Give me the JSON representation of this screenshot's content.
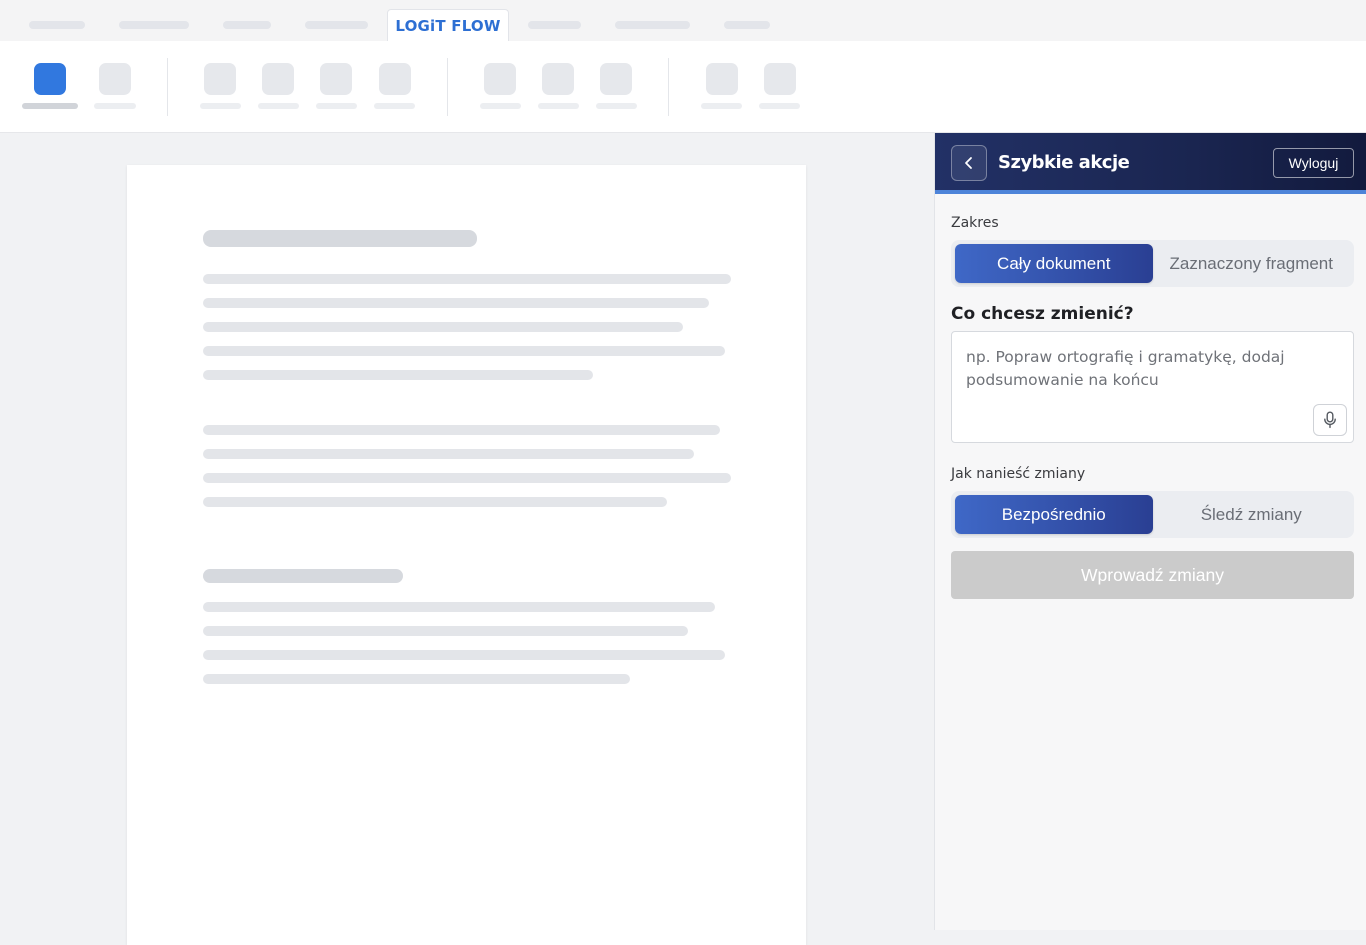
{
  "tabs": {
    "active_label": "LOGiT FLOW"
  },
  "panel": {
    "title": "Szybkie akcje",
    "logout_label": "Wyloguj",
    "scope": {
      "label": "Zakres",
      "options": [
        "Cały dokument",
        "Zaznaczony fragment"
      ],
      "selected": "Cały dokument"
    },
    "change_request": {
      "heading": "Co chcesz zmienić?",
      "placeholder": "np. Popraw ortografię i gramatykę, dodaj podsumowanie na końcu",
      "value": ""
    },
    "apply_mode": {
      "label": "Jak nanieść zmiany",
      "options": [
        "Bezpośrednio",
        "Śledź zmiany"
      ],
      "selected": "Bezpośrednio"
    },
    "apply_button_label": "Wprowadź zmiany"
  },
  "colors": {
    "accent_blue": "#3178df",
    "header_navy": "#1a2550",
    "header_border": "#4d84d9",
    "segment_active_start": "#3f68c7",
    "segment_active_end": "#2a3f93",
    "disabled_button": "#cbcbcb",
    "tab_text": "#2d6fd3"
  },
  "icons": {
    "back": "chevron-left-icon",
    "mic": "microphone-icon"
  }
}
